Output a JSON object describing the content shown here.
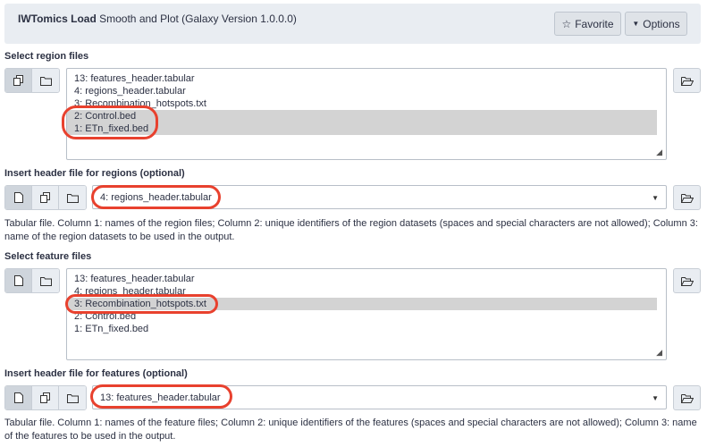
{
  "header": {
    "tool_name": "IWTomics Load",
    "tool_subtitle": "Smooth and Plot (Galaxy Version 1.0.0.0)",
    "favorite_label": "Favorite",
    "options_label": "Options"
  },
  "region_files": {
    "label": "Select region files",
    "items": [
      {
        "label": "13: features_header.tabular",
        "selected": false
      },
      {
        "label": "4: regions_header.tabular",
        "selected": false
      },
      {
        "label": "3: Recombination_hotspots.txt",
        "selected": false
      },
      {
        "label": "2: Control.bed",
        "selected": true
      },
      {
        "label": "1: ETn_fixed.bed",
        "selected": true
      }
    ]
  },
  "region_header": {
    "label": "Insert header file for regions (optional)",
    "value": "4: regions_header.tabular",
    "help": "Tabular file. Column 1: names of the region files; Column 2: unique identifiers of the region datasets (spaces and special characters are not allowed); Column 3: name of the region datasets to be used in the output."
  },
  "feature_files": {
    "label": "Select feature files",
    "items": [
      {
        "label": "13: features_header.tabular",
        "selected": false
      },
      {
        "label": "4: regions_header.tabular",
        "selected": false
      },
      {
        "label": "3: Recombination_hotspots.txt",
        "selected": true
      },
      {
        "label": "2: Control.bed",
        "selected": false
      },
      {
        "label": "1: ETn_fixed.bed",
        "selected": false
      }
    ]
  },
  "feature_header": {
    "label": "Insert header file for features (optional)",
    "value": "13: features_header.tabular",
    "help": "Tabular file. Column 1: names of the feature files; Column 2: unique identifiers of the features (spaces and special characters are not allowed); Column 3: name of the features to be used in the output."
  },
  "colors": {
    "highlight": "#e8412e",
    "selected_row": "#d3d3d3",
    "header_bg": "#e9edf2"
  }
}
